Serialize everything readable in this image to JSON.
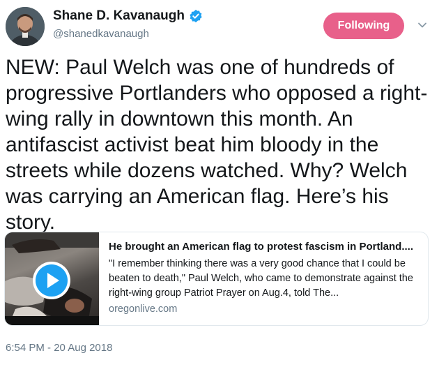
{
  "author": {
    "name": "Shane D. Kavanaugh",
    "handle": "@shanedkavanaugh",
    "verified": true
  },
  "follow_button": {
    "label": "Following",
    "color": "#e0245e"
  },
  "tweet": {
    "text": "NEW: Paul Welch was one of hundreds of progressive Portlanders who opposed a right-wing rally in downtown this month. An antifascist activist beat him bloody in the streets while dozens watched. Why? Welch was carrying an American flag. Here’s his story.",
    "timestamp": "6:54 PM - 20 Aug 2018"
  },
  "link_card": {
    "title": "He brought an American flag to protest fascism in Portland....",
    "description": "\"I remember thinking there was a very good chance that I could be beaten to death,\" Paul Welch, who came to demonstrate against the right-wing group Patriot Prayer on Aug.4, told The...",
    "domain": "oregonlive.com",
    "thumbnail_icon": "play-icon"
  },
  "icons": {
    "verified": "verified-badge-icon",
    "caret": "chevron-down-icon"
  },
  "colors": {
    "verified": "#1da1f2",
    "secondary_text": "#657786",
    "play": "#1da1f2"
  }
}
